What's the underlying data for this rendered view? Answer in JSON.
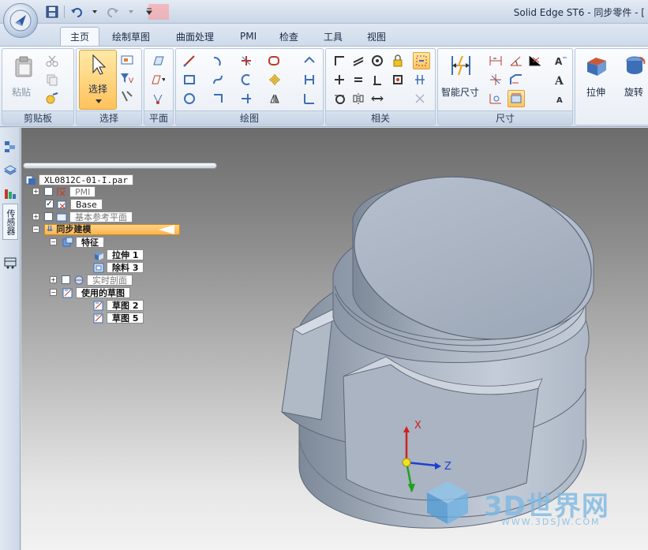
{
  "window": {
    "title": "Solid Edge ST6 - 同步零件 - ["
  },
  "ribbon_tabs": [
    {
      "label": "主页",
      "active": true
    },
    {
      "label": "绘制草图"
    },
    {
      "label": "曲面处理"
    },
    {
      "label": "PMI"
    },
    {
      "label": "检查"
    },
    {
      "label": "工具"
    },
    {
      "label": "视图"
    }
  ],
  "groups": {
    "clipboard": {
      "label": "剪贴板",
      "paste_label": "粘贴"
    },
    "select": {
      "label": "选择",
      "select_label": "选择"
    },
    "plane": {
      "label": "平面"
    },
    "draw": {
      "label": "绘图"
    },
    "relate": {
      "label": "相关"
    },
    "dimension": {
      "label": "尺寸",
      "smart_dim_label": "智能尺寸"
    },
    "solids": {
      "extrude_label": "拉伸",
      "revolve_label": "旋转"
    }
  },
  "pathfinder": {
    "root": "XL0812C-01-I.par",
    "items": [
      {
        "label": "PMI"
      },
      {
        "label": "Base"
      },
      {
        "label": "基本参考平面"
      },
      {
        "label": "同步建模"
      },
      {
        "label": "特征"
      },
      {
        "label": "拉伸 1"
      },
      {
        "label": "除料 3"
      },
      {
        "label": "实时剖面"
      },
      {
        "label": "使用的草图"
      },
      {
        "label": "草图 2"
      },
      {
        "label": "草图 5"
      }
    ]
  },
  "left_strip": {
    "vertical_label": "传感器"
  },
  "triad": {
    "x": "X",
    "y": "Y",
    "z": "Z"
  },
  "watermark": {
    "text": "3D世界网",
    "url": "WWW.3DSJW.COM"
  },
  "colors": {
    "accent_orange": "#ffb34a",
    "ribbon_blue": "#c9d5e6",
    "model_blue_gray": "#9fa9b8"
  }
}
